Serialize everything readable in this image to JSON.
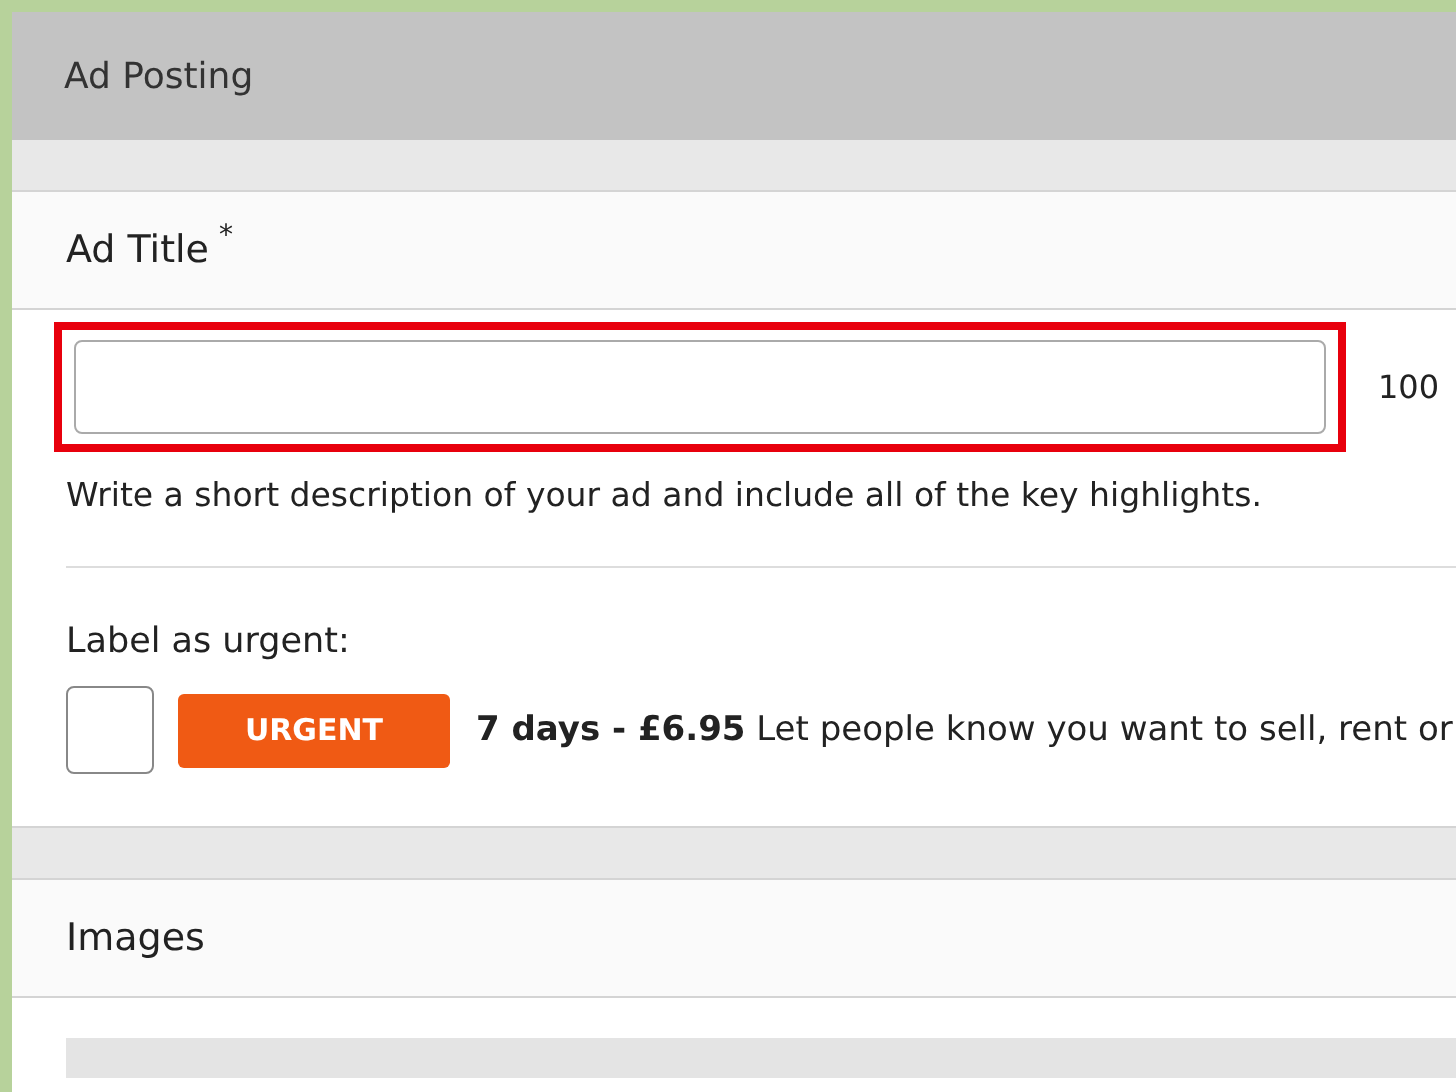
{
  "header": {
    "title": "Ad Posting"
  },
  "ad_title": {
    "label": "Ad Title",
    "required_mark": "*",
    "highlighted": true,
    "counter": "100",
    "hint": "Write a short description of your ad and include all of the key highlights."
  },
  "urgent": {
    "label": "Label as urgent:",
    "checked": false,
    "badge": "URGENT",
    "description": "**7 days - £6.95** Let people know you want to sell, rent or"
  },
  "images": {
    "title": "Images"
  }
}
